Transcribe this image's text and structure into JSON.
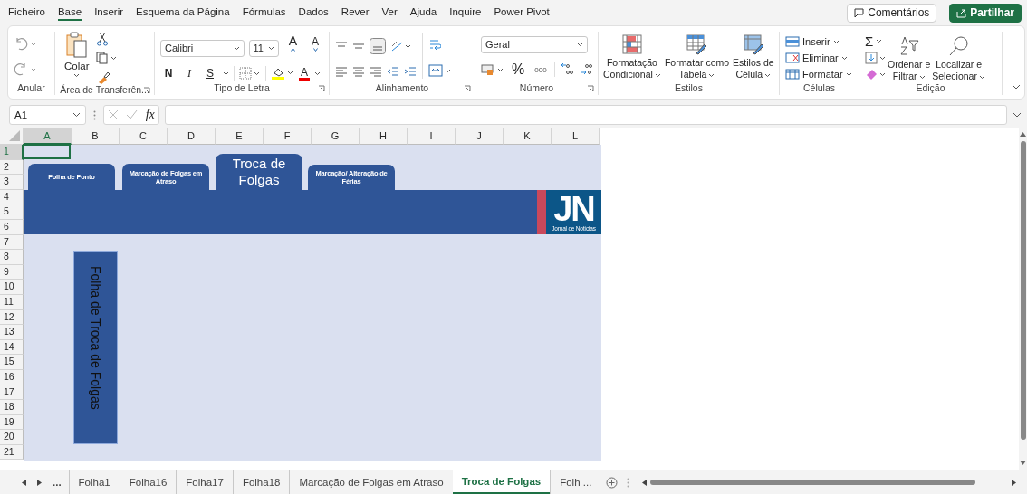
{
  "menu_tabs": [
    {
      "label": "Ficheiro",
      "selected": false
    },
    {
      "label": "Base",
      "selected": true
    },
    {
      "label": "Inserir",
      "selected": false
    },
    {
      "label": "Esquema da Página",
      "selected": false
    },
    {
      "label": "Fórmulas",
      "selected": false
    },
    {
      "label": "Dados",
      "selected": false
    },
    {
      "label": "Rever",
      "selected": false
    },
    {
      "label": "Ver",
      "selected": false
    },
    {
      "label": "Ajuda",
      "selected": false
    },
    {
      "label": "Inquire",
      "selected": false
    },
    {
      "label": "Power Pivot",
      "selected": false
    }
  ],
  "header_buttons": [
    {
      "label": "Comentários",
      "kind": "comments"
    },
    {
      "label": "Partilhar",
      "kind": "share"
    }
  ],
  "ribbon": {
    "undo": {
      "group_label": "Anular"
    },
    "clipboard": {
      "group_label": "Área de Transferên...",
      "paste_label": "Colar"
    },
    "font": {
      "group_label": "Tipo de Letra",
      "font_name": "Calibri",
      "font_size": "11",
      "grow_label": "A",
      "shrink_label": "A",
      "style_buttons": [
        {
          "label": "N",
          "kind": "bold"
        },
        {
          "label": "I",
          "kind": "italic"
        },
        {
          "label": "S",
          "kind": "underline"
        }
      ],
      "font_color_label": "A"
    },
    "alignment": {
      "group_label": "Alinhamento"
    },
    "number": {
      "group_label": "Número",
      "format": "Geral",
      "percent_label": "%",
      "thousands_label": "000"
    },
    "styles": {
      "group_label": "Estilos",
      "buttons": [
        {
          "lines": [
            "Formatação",
            "Condicional"
          ],
          "kind": "conditional"
        },
        {
          "lines": [
            "Formatar como",
            "Tabela"
          ],
          "kind": "table"
        },
        {
          "lines": [
            "Estilos de",
            "Célula"
          ],
          "kind": "cell"
        }
      ]
    },
    "cells": {
      "group_label": "Células",
      "buttons": [
        {
          "label": "Inserir",
          "kind": "insert"
        },
        {
          "label": "Eliminar",
          "kind": "delete"
        },
        {
          "label": "Formatar",
          "kind": "format"
        }
      ]
    },
    "editing": {
      "group_label": "Edição",
      "autosum_label": "Σ",
      "buttons": [
        {
          "lines": [
            "Ordenar e",
            "Filtrar"
          ],
          "kind": "sort"
        },
        {
          "lines": [
            "Localizar e",
            "Selecionar"
          ],
          "kind": "find"
        }
      ]
    }
  },
  "formula_bar": {
    "name_box": "A1",
    "function_label": "fx"
  },
  "columns": [
    {
      "label": "A",
      "selected": true
    },
    {
      "label": "B",
      "selected": false
    },
    {
      "label": "C",
      "selected": false
    },
    {
      "label": "D",
      "selected": false
    },
    {
      "label": "E",
      "selected": false
    },
    {
      "label": "F",
      "selected": false
    },
    {
      "label": "G",
      "selected": false
    },
    {
      "label": "H",
      "selected": false
    },
    {
      "label": "I",
      "selected": false
    },
    {
      "label": "J",
      "selected": false
    },
    {
      "label": "K",
      "selected": false
    },
    {
      "label": "L",
      "selected": false
    }
  ],
  "rows": [
    {
      "label": "1",
      "selected": true
    },
    {
      "label": "2",
      "selected": false
    },
    {
      "label": "3",
      "selected": false
    },
    {
      "label": "4",
      "selected": false
    },
    {
      "label": "5",
      "selected": false
    },
    {
      "label": "6",
      "selected": false
    },
    {
      "label": "7",
      "selected": false
    },
    {
      "label": "8",
      "selected": false
    },
    {
      "label": "9",
      "selected": false
    },
    {
      "label": "10",
      "selected": false
    },
    {
      "label": "11",
      "selected": false
    },
    {
      "label": "12",
      "selected": false
    },
    {
      "label": "13",
      "selected": false
    },
    {
      "label": "14",
      "selected": false
    },
    {
      "label": "15",
      "selected": false
    },
    {
      "label": "16",
      "selected": false
    },
    {
      "label": "17",
      "selected": false
    },
    {
      "label": "18",
      "selected": false
    },
    {
      "label": "19",
      "selected": false
    },
    {
      "label": "20",
      "selected": false
    },
    {
      "label": "21",
      "selected": false
    }
  ],
  "sheet": {
    "nav_tabs": [
      {
        "label": "Folha de Ponto",
        "selected": false
      },
      {
        "label": "Marcação de Folgas em Atraso",
        "selected": false
      },
      {
        "label": "Troca de Folgas",
        "selected": true
      },
      {
        "label": "Marcação/ Alteração de Férias",
        "selected": false
      }
    ],
    "vertical_title": "Folha de Troca de Folgas",
    "logo": {
      "mark": "JN",
      "caption": "Jornal de Notícias"
    }
  },
  "sheet_tabs": {
    "overflow_left": "...",
    "tabs": [
      {
        "label": "Folha1",
        "selected": false
      },
      {
        "label": "Folha16",
        "selected": false
      },
      {
        "label": "Folha17",
        "selected": false
      },
      {
        "label": "Folha18",
        "selected": false
      },
      {
        "label": "Marcação de Folgas em Atraso",
        "selected": false
      },
      {
        "label": "Troca de Folgas",
        "selected": true
      },
      {
        "label": "Folh ...",
        "selected": false
      }
    ]
  }
}
